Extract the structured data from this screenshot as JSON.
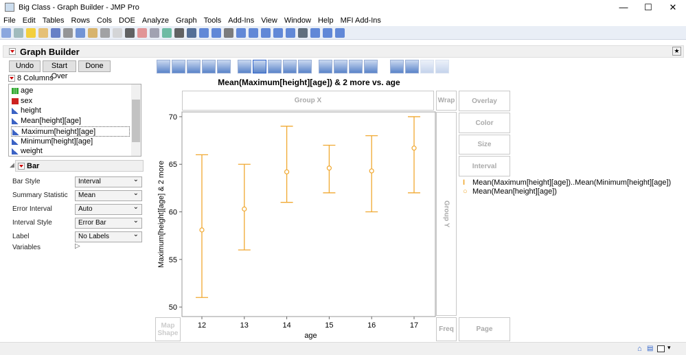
{
  "window": {
    "title": "Big Class - Graph Builder - JMP Pro",
    "minimize": "—",
    "maximize": "☐",
    "close": "✕"
  },
  "menu": [
    "File",
    "Edit",
    "Tables",
    "Rows",
    "Cols",
    "DOE",
    "Analyze",
    "Graph",
    "Tools",
    "Add-Ins",
    "View",
    "Window",
    "Help",
    "MFI Add-Ins"
  ],
  "graph_builder": {
    "title": "Graph Builder",
    "undo": "Undo",
    "start_over": "Start Over",
    "done": "Done",
    "columns_header": "8 Columns",
    "columns": [
      {
        "name": "age",
        "type": "ordinal"
      },
      {
        "name": "sex",
        "type": "nominal"
      },
      {
        "name": "height",
        "type": "continuous"
      },
      {
        "name": "Mean[height][age]",
        "type": "continuous"
      },
      {
        "name": "Maximum[height][age]",
        "type": "continuous",
        "selected": true
      },
      {
        "name": "Minimum[height][age]",
        "type": "continuous"
      },
      {
        "name": "weight",
        "type": "continuous"
      }
    ],
    "element": "Bar",
    "properties": [
      {
        "label": "Bar Style",
        "value": "Interval"
      },
      {
        "label": "Summary Statistic",
        "value": "Mean"
      },
      {
        "label": "Error Interval",
        "value": "Auto"
      },
      {
        "label": "Interval Style",
        "value": "Error Bar"
      },
      {
        "label": "Label",
        "value": "No Labels"
      }
    ],
    "variables_label": "Variables",
    "zones": {
      "group_x": "Group X",
      "wrap": "Wrap",
      "overlay": "Overlay",
      "color": "Color",
      "size": "Size",
      "interval": "Interval",
      "group_y": "Group Y",
      "freq": "Freq",
      "page": "Page",
      "map_shape": "Map Shape"
    }
  },
  "chart_data": {
    "type": "interval",
    "title": "Mean(Maximum[height][age]) & 2 more vs. age",
    "xlabel": "age",
    "ylabel": "Maximum[height][age] & 2 more",
    "categories": [
      "12",
      "13",
      "14",
      "15",
      "16",
      "17"
    ],
    "ylim": [
      49,
      70.5
    ],
    "yticks": [
      50,
      55,
      60,
      65,
      70
    ],
    "upper": [
      66,
      65,
      69,
      67,
      68,
      70
    ],
    "lower": [
      51,
      56,
      61,
      62,
      60,
      62
    ],
    "mean": [
      58.1,
      60.3,
      64.2,
      64.6,
      64.3,
      66.7
    ],
    "color": "#f0a830",
    "legend": [
      "Mean(Maximum[height][age])..Mean(Minimum[height][age])",
      "Mean(Mean[height][age])"
    ]
  }
}
